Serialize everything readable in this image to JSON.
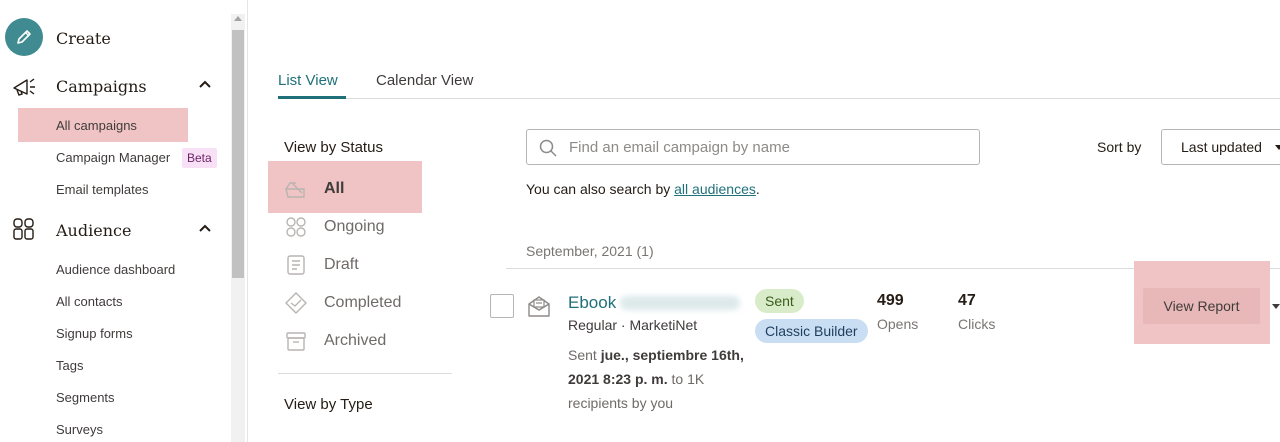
{
  "sidebar": {
    "create_label": "Create",
    "campaigns_label": "Campaigns",
    "campaign_items": [
      {
        "label": "All campaigns"
      },
      {
        "label": "Campaign Manager"
      },
      {
        "label": "Email templates"
      }
    ],
    "beta_badge": "Beta",
    "audience_label": "Audience",
    "audience_items": [
      {
        "label": "Audience dashboard"
      },
      {
        "label": "All contacts"
      },
      {
        "label": "Signup forms"
      },
      {
        "label": "Tags"
      },
      {
        "label": "Segments"
      },
      {
        "label": "Surveys"
      }
    ]
  },
  "tabs": [
    {
      "label": "List View",
      "active": true
    },
    {
      "label": "Calendar View",
      "active": false
    }
  ],
  "status_filter": {
    "title": "View by Status",
    "items": [
      {
        "label": "All",
        "icon": "all-icon",
        "active": true
      },
      {
        "label": "Ongoing",
        "icon": "ongoing-icon"
      },
      {
        "label": "Draft",
        "icon": "draft-icon"
      },
      {
        "label": "Completed",
        "icon": "completed-icon"
      },
      {
        "label": "Archived",
        "icon": "archived-icon"
      }
    ]
  },
  "type_filter": {
    "title": "View by Type"
  },
  "search": {
    "placeholder": "Find an email campaign by name",
    "value": "",
    "hint_prefix": "You can also search by ",
    "hint_link": "all audiences",
    "hint_suffix": "."
  },
  "sort": {
    "label": "Sort by",
    "selected": "Last updated"
  },
  "list": {
    "group_heading": "September, 2021 (1)",
    "campaigns": [
      {
        "name": "Ebook",
        "meta": "Regular · MarketiNet",
        "sent_prefix": "Sent ",
        "sent_date": "jue., septiembre 16th, 2021 8:23 p. m.",
        "sent_suffix": " to 1K recipients by you",
        "status_badge": "Sent",
        "builder_badge": "Classic Builder",
        "opens_value": "499",
        "opens_label": "Opens",
        "clicks_value": "47",
        "clicks_label": "Clicks",
        "action_label": "View Report"
      }
    ]
  },
  "colors": {
    "accent": "#20707a",
    "highlight": "#f0c4c4",
    "create_button": "#3f8b91",
    "sent_badge": "#d8ecc9",
    "builder_badge": "#c9def2"
  }
}
